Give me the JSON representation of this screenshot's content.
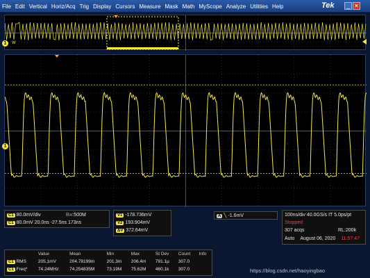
{
  "menu": [
    "File",
    "Edit",
    "Vertical",
    "Horiz/Acq",
    "Trig",
    "Display",
    "Cursors",
    "Measure",
    "Mask",
    "Math",
    "MyScope",
    "Analyze",
    "Utilities",
    "Help"
  ],
  "brand": "Tek",
  "overview": {
    "ch_label": "1",
    "marker_label": "W"
  },
  "main": {
    "ch_label": "1"
  },
  "channel": {
    "tag": "C1",
    "scale": "80.0mV/div",
    "bw_icon": "B",
    "bw": "500M",
    "row2_scale": "80.0mV",
    "row2_time": "20.0ns",
    "row2_offset": "-27.5ns",
    "row2_total": "173ns"
  },
  "cursors": {
    "v1_tag": "V1",
    "v1": "-178.736mV",
    "v2_tag": "V2",
    "v2": "193.904mV",
    "dv_tag": "ΔV",
    "dv": "372.64mV"
  },
  "trigger": {
    "tag": "A",
    "level": "-1.6mV"
  },
  "acquisition": {
    "timebase": "100ns/div",
    "rate": "40.0GS/s",
    "mode": "IT",
    "resolution": "5.0ps/pt",
    "status": "Stopped",
    "acqs": "307 acqs",
    "rl": "RL:200k",
    "trig_mode": "Auto",
    "date": "August 06, 2020",
    "time": "11:57:47"
  },
  "measurements": {
    "headers": [
      "",
      "Value",
      "Mean",
      "Min",
      "Max",
      "St Dev",
      "Count",
      "Info"
    ],
    "rows": [
      {
        "tag": "C1",
        "name": "RMS",
        "value": "205.1mV",
        "mean": "204.78199m",
        "min": "201.3m",
        "max": "206.4m",
        "stdev": "791.1µ",
        "count": "307.0",
        "info": ""
      },
      {
        "tag": "C1",
        "name": "Freq*",
        "value": "74.24MHz",
        "mean": "74.254835M",
        "min": "73.19M",
        "max": "75.62M",
        "stdev": "460.1k",
        "count": "307.0",
        "info": ""
      }
    ]
  },
  "watermark": "https://blog.csdn.net/haoyingbao",
  "colors": {
    "trace": "#f2e84b",
    "background": "#000000",
    "menubar": "#2a5aa8"
  },
  "waveform": {
    "cycles": 15,
    "peak_mv": 155,
    "trough_mv": -190,
    "vertical_scale_mv_per_div": 80
  }
}
